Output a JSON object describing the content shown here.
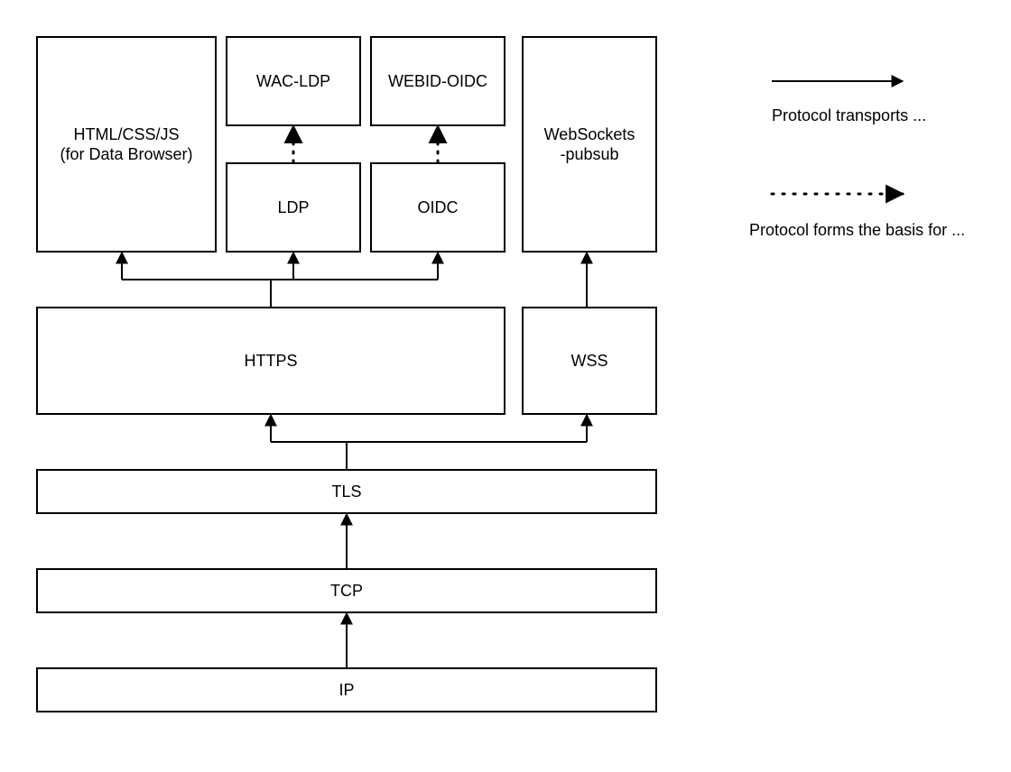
{
  "boxes": {
    "html_data_browser": {
      "line1": "HTML/CSS/JS",
      "line2": "(for Data Browser)"
    },
    "wac_ldp": "WAC-LDP",
    "webid_oidc": "WEBID-OIDC",
    "websockets": {
      "line1": "WebSockets",
      "line2": "-pubsub"
    },
    "ldp": "LDP",
    "oidc": "OIDC",
    "https": "HTTPS",
    "wss": "WSS",
    "tls": "TLS",
    "tcp": "TCP",
    "ip": "IP"
  },
  "legend": {
    "transports": "Protocol transports ...",
    "basis": "Protocol forms the basis for ..."
  },
  "relationships": {
    "transports": [
      [
        "IP",
        "TCP"
      ],
      [
        "TCP",
        "TLS"
      ],
      [
        "TLS",
        "HTTPS"
      ],
      [
        "TLS",
        "WSS"
      ],
      [
        "HTTPS",
        "HTML/CSS/JS"
      ],
      [
        "HTTPS",
        "LDP"
      ],
      [
        "HTTPS",
        "OIDC"
      ],
      [
        "WSS",
        "WebSockets-pubsub"
      ]
    ],
    "forms_basis_for": [
      [
        "LDP",
        "WAC-LDP"
      ],
      [
        "OIDC",
        "WEBID-OIDC"
      ]
    ]
  }
}
